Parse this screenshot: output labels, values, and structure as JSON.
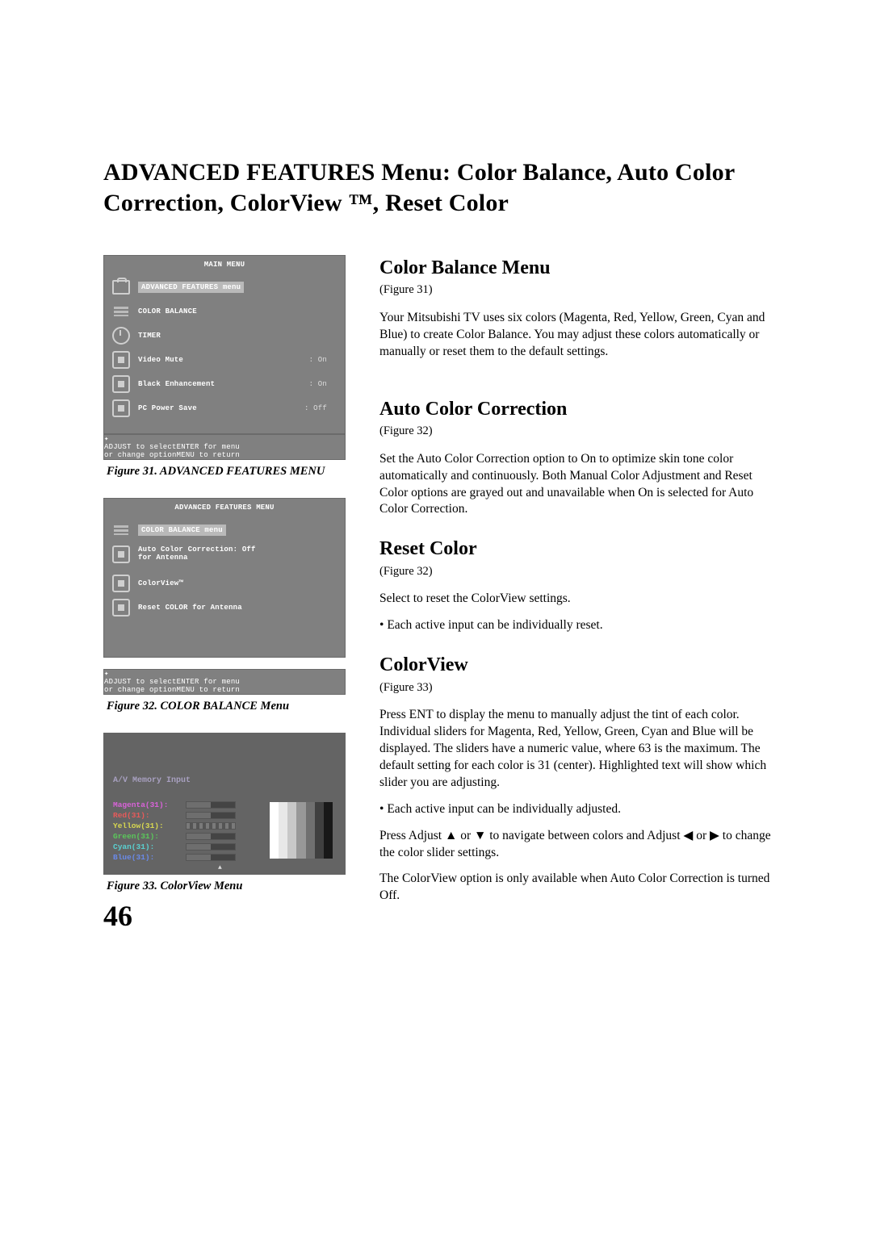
{
  "title": "ADVANCED FEATURES Menu: Color Balance, Auto Color Correction, ColorView ™, Reset Color",
  "pageNumber": "46",
  "fig31": {
    "menuTitle": "MAIN MENU",
    "items": [
      {
        "label": "ADVANCED FEATURES menu",
        "value": "",
        "iconStyle": "toolbox",
        "highlighted": true
      },
      {
        "label": "COLOR BALANCE",
        "value": "",
        "iconStyle": "bars"
      },
      {
        "label": "TIMER",
        "value": "",
        "iconStyle": "clock"
      },
      {
        "label": "Video Mute",
        "value": "On",
        "iconStyle": "square"
      },
      {
        "label": "Black Enhancement",
        "value": "On",
        "iconStyle": "square"
      },
      {
        "label": "PC Power Save",
        "value": "Off",
        "iconStyle": "square"
      }
    ],
    "footer": {
      "adjust": "ADJUST to select",
      "change": "or change option",
      "enter": "ENTER for menu",
      "menu": "MENU  to return"
    },
    "caption": "Figure 31. ADVANCED FEATURES MENU"
  },
  "fig32": {
    "menuTitle": "ADVANCED FEATURES MENU",
    "items": [
      {
        "label": "COLOR BALANCE menu",
        "value": "",
        "iconStyle": "bars",
        "highlighted": true
      },
      {
        "label": "Auto Color Correction: Off\nfor Antenna",
        "value": "",
        "iconStyle": "square",
        "twoLine": true
      },
      {
        "label": "ColorView™",
        "value": "",
        "iconStyle": "square"
      },
      {
        "label": "Reset COLOR for Antenna",
        "value": "",
        "iconStyle": "square"
      }
    ],
    "footer": {
      "adjust": "ADJUST to select",
      "change": "or change option",
      "enter": "ENTER for menu",
      "menu": "MENU  to return"
    },
    "caption": "Figure 32.  COLOR BALANCE Menu"
  },
  "fig33": {
    "header": "A/V Memory Input",
    "sliders": [
      {
        "label": "Magenta(31):",
        "cls": "magenta"
      },
      {
        "label": "Red(31):",
        "cls": "red"
      },
      {
        "label": "Yellow(31):",
        "cls": "yellow",
        "dashed": true
      },
      {
        "label": "Green(31):",
        "cls": "green"
      },
      {
        "label": "Cyan(31):",
        "cls": "cyan"
      },
      {
        "label": "Blue(31):",
        "cls": "blue"
      }
    ],
    "caption": "Figure 33. ColorView Menu",
    "barsColors": [
      "#ffffff",
      "#e8e8e8",
      "#c8c8c8",
      "#989898",
      "#707070",
      "#404040",
      "#181818"
    ]
  },
  "body": {
    "s1": {
      "h": "Color Balance Menu",
      "sub": "(Figure 31)",
      "p1": "Your Mitsubishi TV uses six colors (Magenta, Red, Yellow, Green, Cyan and Blue) to create Color Balance.  You may adjust these colors automatically or manually or reset them to the default settings."
    },
    "s2": {
      "h": "Auto Color Correction",
      "sub": "(Figure 32)",
      "p1": "Set the Auto Color Correction option to On to optimize skin tone color automatically and continuously.  Both Manual Color Adjustment and Reset Color options are grayed out and unavailable when On is selected for Auto Color Correction."
    },
    "s3": {
      "h": "Reset Color",
      "sub": "(Figure 32)",
      "p1": "Select to reset the ColorView settings.",
      "b1": "Each active input can be individually reset."
    },
    "s4": {
      "h": "ColorView",
      "sub": "(Figure 33)",
      "p1": "Press ENT to display the menu to manually adjust the tint of each color.  Individual sliders for Magenta, Red, Yellow, Green, Cyan and Blue will be displayed. The sliders have a numeric value, where 63 is the maximum. The default setting for each color is 31 (center).  Highlighted text will show which slider you are adjusting.",
      "b1": "Each active input can be individually adjusted.",
      "p2a": "Press Adjust ",
      "p2b": " or ",
      "p2c": "  to navigate between colors and Adjust ",
      "p2d": " or ",
      "p2e": "  to change the color slider settings.",
      "p3": "The ColorView option is only available when Auto Color Correction is turned Off."
    }
  }
}
